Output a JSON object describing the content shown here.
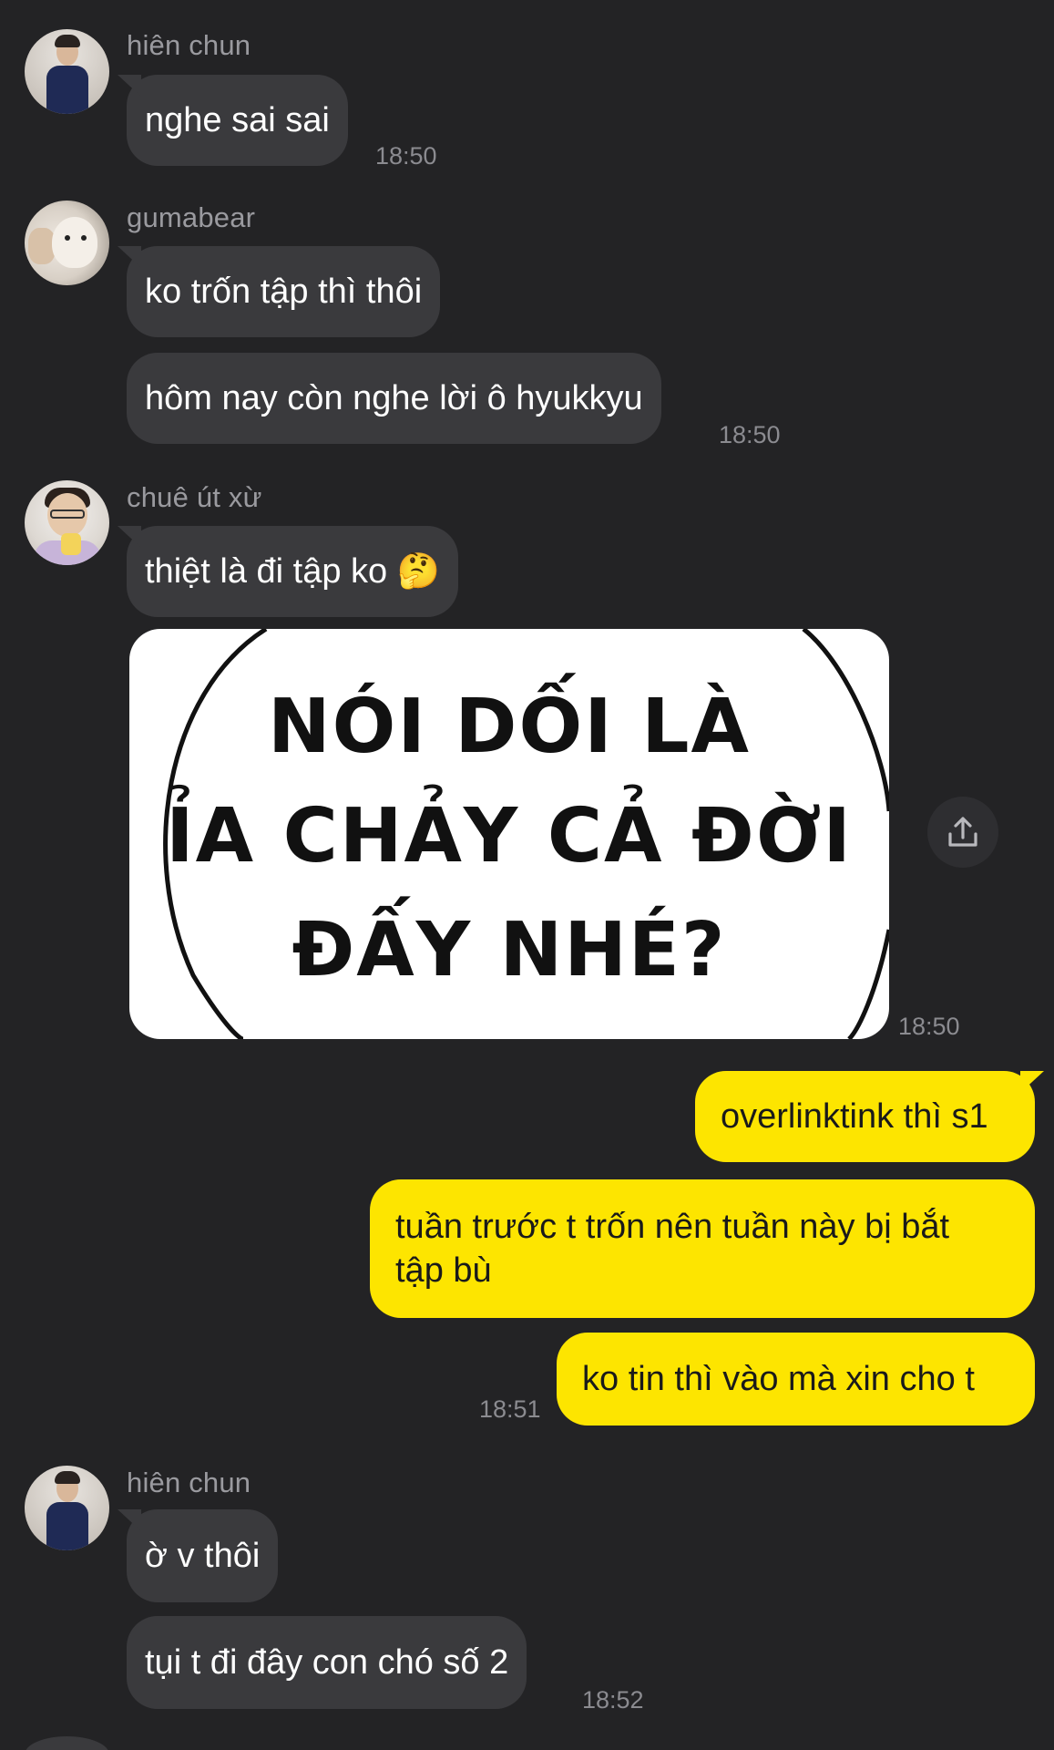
{
  "messages": {
    "g1": {
      "sender": "hiên chun",
      "text": "nghe sai sai",
      "time": "18:50"
    },
    "g2": {
      "sender": "gumabear",
      "text1": "ko trốn tập thì thôi",
      "text2": "hôm nay còn nghe lời ô hyukkyu",
      "time": "18:50"
    },
    "g3": {
      "sender": "chuê út xừ",
      "text": "thiệt là đi tập ko 🤔",
      "time": "18:50"
    },
    "meme": {
      "line1": "NÓI DỐI LÀ",
      "line2": "ỈA CHẢY CẢ ĐỜI",
      "line3": "ĐẤY NHÉ?"
    },
    "out": {
      "text1": "overlinktink thì s1",
      "text2": "tuần trước t trốn nên tuần này bị bắt tập bù",
      "text3": "ko tin thì vào mà xin cho t",
      "time": "18:51"
    },
    "g4": {
      "sender": "hiên chun",
      "text1": "ờ v thôi",
      "text2": "tụi t đi đây con chó số 2",
      "time": "18:52"
    }
  },
  "icons": {
    "share": "share-upload-icon"
  },
  "colors": {
    "background": "#232325",
    "incoming_bubble": "#3a3a3d",
    "outgoing_bubble": "#fde500"
  }
}
